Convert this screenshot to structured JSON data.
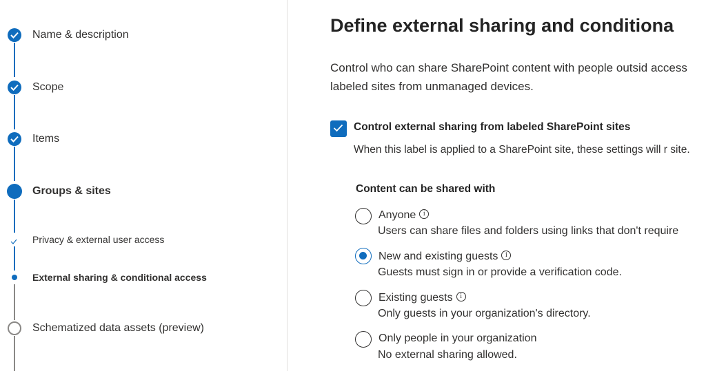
{
  "wizard": {
    "steps": [
      {
        "label": "Name & description",
        "state": "completed",
        "icon": "checkmark-icon"
      },
      {
        "label": "Scope",
        "state": "completed",
        "icon": "checkmark-icon"
      },
      {
        "label": "Items",
        "state": "completed",
        "icon": "checkmark-icon"
      },
      {
        "label": "Groups & sites",
        "state": "current",
        "icon": "filled-circle-icon"
      }
    ],
    "substeps": [
      {
        "label": "Privacy & external user access",
        "state": "completed",
        "icon": "small-checkmark-icon"
      },
      {
        "label": "External sharing & conditional access",
        "state": "current",
        "icon": "dot-icon"
      }
    ],
    "next_step": {
      "label": "Schematized data assets (preview)",
      "state": "not-started",
      "icon": "empty-circle-icon"
    }
  },
  "main": {
    "title": "Define external sharing and conditiona",
    "description": "Control who can share SharePoint content with people outsid access labeled sites from unmanaged devices.",
    "control_sharing": {
      "checked": true,
      "label": "Control external sharing from labeled SharePoint sites",
      "description": "When this label is applied to a SharePoint site, these settings will r site."
    },
    "sharing_section_label": "Content can be shared with",
    "sharing_options": [
      {
        "label": "Anyone",
        "description": "Users can share files and folders using links that don't require",
        "selected": false,
        "info_icon": "info-icon"
      },
      {
        "label": "New and existing guests",
        "description": "Guests must sign in or provide a verification code.",
        "selected": true,
        "info_icon": "info-icon"
      },
      {
        "label": "Existing guests",
        "description": "Only guests in your organization's directory.",
        "selected": false,
        "info_icon": "info-icon"
      },
      {
        "label": "Only people in your organization",
        "description": "No external sharing allowed.",
        "selected": false
      }
    ]
  },
  "colors": {
    "accent": "#0f6cbd",
    "rail_inactive": "#8a8886",
    "text": "#323130",
    "divider": "#e1dfdd"
  }
}
